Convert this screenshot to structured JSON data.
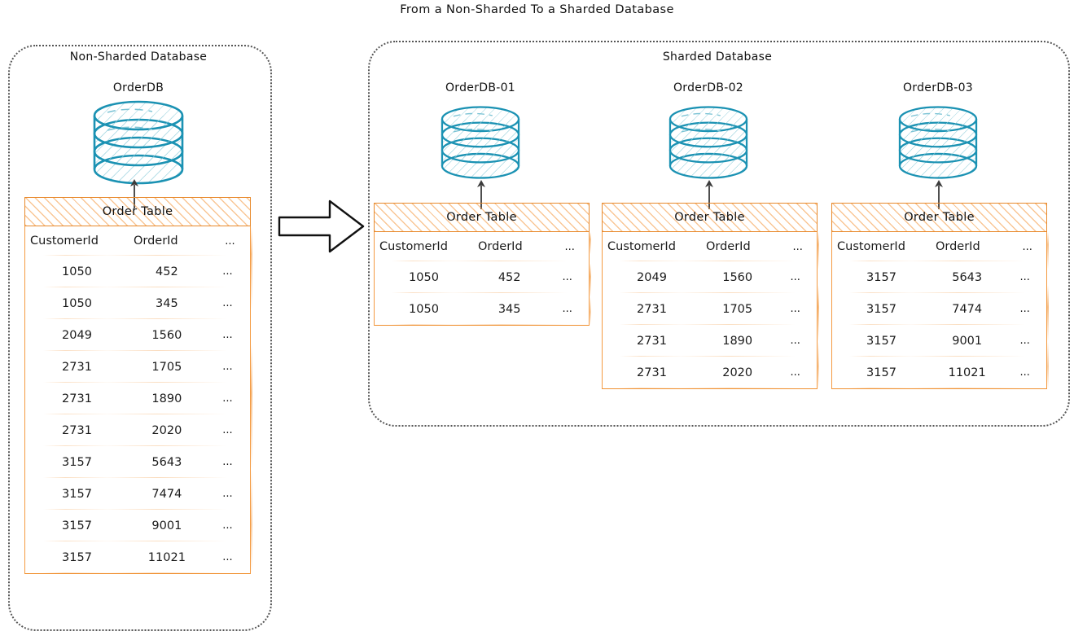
{
  "title": "From a Non-Sharded To a Sharded Database",
  "accent_colors": {
    "table_orange": "#f0902f",
    "db_teal": "#1b92b3",
    "panel_border": "#555555",
    "text": "#111111"
  },
  "left_panel": {
    "name": "Non-Sharded Database",
    "database": {
      "label": "OrderDB",
      "icon": "database-cylinder-icon"
    },
    "table": {
      "header": "Order Table",
      "columns": [
        "CustomerId",
        "OrderId",
        "..."
      ],
      "rows": [
        [
          "1050",
          "452",
          "..."
        ],
        [
          "1050",
          "345",
          "..."
        ],
        [
          "2049",
          "1560",
          "..."
        ],
        [
          "2731",
          "1705",
          "..."
        ],
        [
          "2731",
          "1890",
          "..."
        ],
        [
          "2731",
          "2020",
          "..."
        ],
        [
          "3157",
          "5643",
          "..."
        ],
        [
          "3157",
          "7474",
          "..."
        ],
        [
          "3157",
          "9001",
          "..."
        ],
        [
          "3157",
          "11021",
          "..."
        ]
      ]
    }
  },
  "transition": {
    "icon": "right-arrow-icon"
  },
  "right_panel": {
    "name": "Sharded Database",
    "shards": [
      {
        "database": {
          "label": "OrderDB-01",
          "icon": "database-cylinder-icon"
        },
        "table": {
          "header": "Order Table",
          "columns": [
            "CustomerId",
            "OrderId",
            "..."
          ],
          "rows": [
            [
              "1050",
              "452",
              "..."
            ],
            [
              "1050",
              "345",
              "..."
            ]
          ]
        }
      },
      {
        "database": {
          "label": "OrderDB-02",
          "icon": "database-cylinder-icon"
        },
        "table": {
          "header": "Order Table",
          "columns": [
            "CustomerId",
            "OrderId",
            "..."
          ],
          "rows": [
            [
              "2049",
              "1560",
              "..."
            ],
            [
              "2731",
              "1705",
              "..."
            ],
            [
              "2731",
              "1890",
              "..."
            ],
            [
              "2731",
              "2020",
              "..."
            ]
          ]
        }
      },
      {
        "database": {
          "label": "OrderDB-03",
          "icon": "database-cylinder-icon"
        },
        "table": {
          "header": "Order Table",
          "columns": [
            "CustomerId",
            "OrderId",
            "..."
          ],
          "rows": [
            [
              "3157",
              "5643",
              "..."
            ],
            [
              "3157",
              "7474",
              "..."
            ],
            [
              "3157",
              "9001",
              "..."
            ],
            [
              "3157",
              "11021",
              "..."
            ]
          ]
        }
      }
    ]
  }
}
